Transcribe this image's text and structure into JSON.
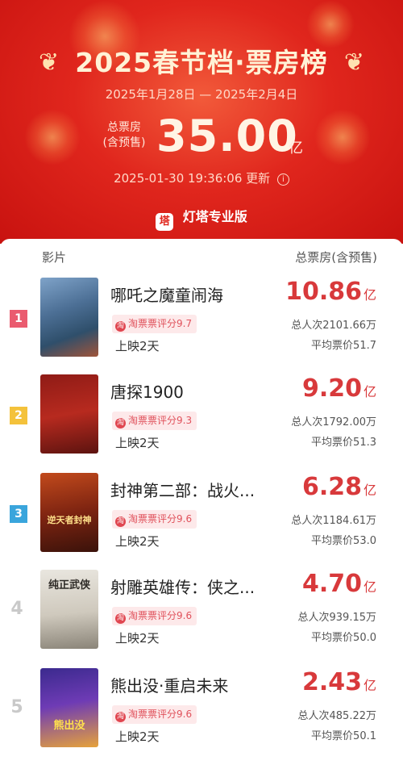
{
  "header": {
    "title": "2025春节档·票房榜",
    "date_range": "2025年1月28日 — 2025年2月4日",
    "total_label_line1": "总票房",
    "total_label_line2": "(含预售)",
    "total_value": "35.00",
    "total_unit": "亿",
    "updated_time": "2025-01-30 19:36:06 更新",
    "info_icon": "ⓘ",
    "brand_name": "灯塔专业版",
    "brand_logo_text": "塔"
  },
  "columns": {
    "film": "影片",
    "box_office": "总票房(含预售)"
  },
  "score_icon_text": "淘",
  "films": [
    {
      "rank": "1",
      "title": "哪吒之魔童闹海",
      "score": "淘票票评分9.7",
      "days": "上映2天",
      "box": "10.86",
      "unit": "亿",
      "admissions": "总人次2101.66万",
      "avg_price": "平均票价51.7"
    },
    {
      "rank": "2",
      "title": "唐探1900",
      "score": "淘票票评分9.3",
      "days": "上映2天",
      "box": "9.20",
      "unit": "亿",
      "admissions": "总人次1792.00万",
      "avg_price": "平均票价51.3"
    },
    {
      "rank": "3",
      "title": "封神第二部：战火...",
      "score": "淘票票评分9.6",
      "days": "上映2天",
      "box": "6.28",
      "unit": "亿",
      "admissions": "总人次1184.61万",
      "avg_price": "平均票价53.0"
    },
    {
      "rank": "4",
      "title": "射雕英雄传：侠之...",
      "score": "淘票票评分9.6",
      "days": "上映2天",
      "box": "4.70",
      "unit": "亿",
      "admissions": "总人次939.15万",
      "avg_price": "平均票价50.0"
    },
    {
      "rank": "5",
      "title": "熊出没·重启未来",
      "score": "淘票票评分9.6",
      "days": "上映2天",
      "box": "2.43",
      "unit": "亿",
      "admissions": "总人次485.22万",
      "avg_price": "平均票价50.1"
    }
  ],
  "poster_captions": {
    "p3": "逆天者封神",
    "p4": "纯正武侠",
    "p5": "熊出没"
  },
  "colors": {
    "header_red": "#e0261d",
    "box_value_red": "#d8393b",
    "rank1": "#ea5b6f",
    "rank2": "#f4c23b",
    "rank3": "#3aa5dc"
  }
}
